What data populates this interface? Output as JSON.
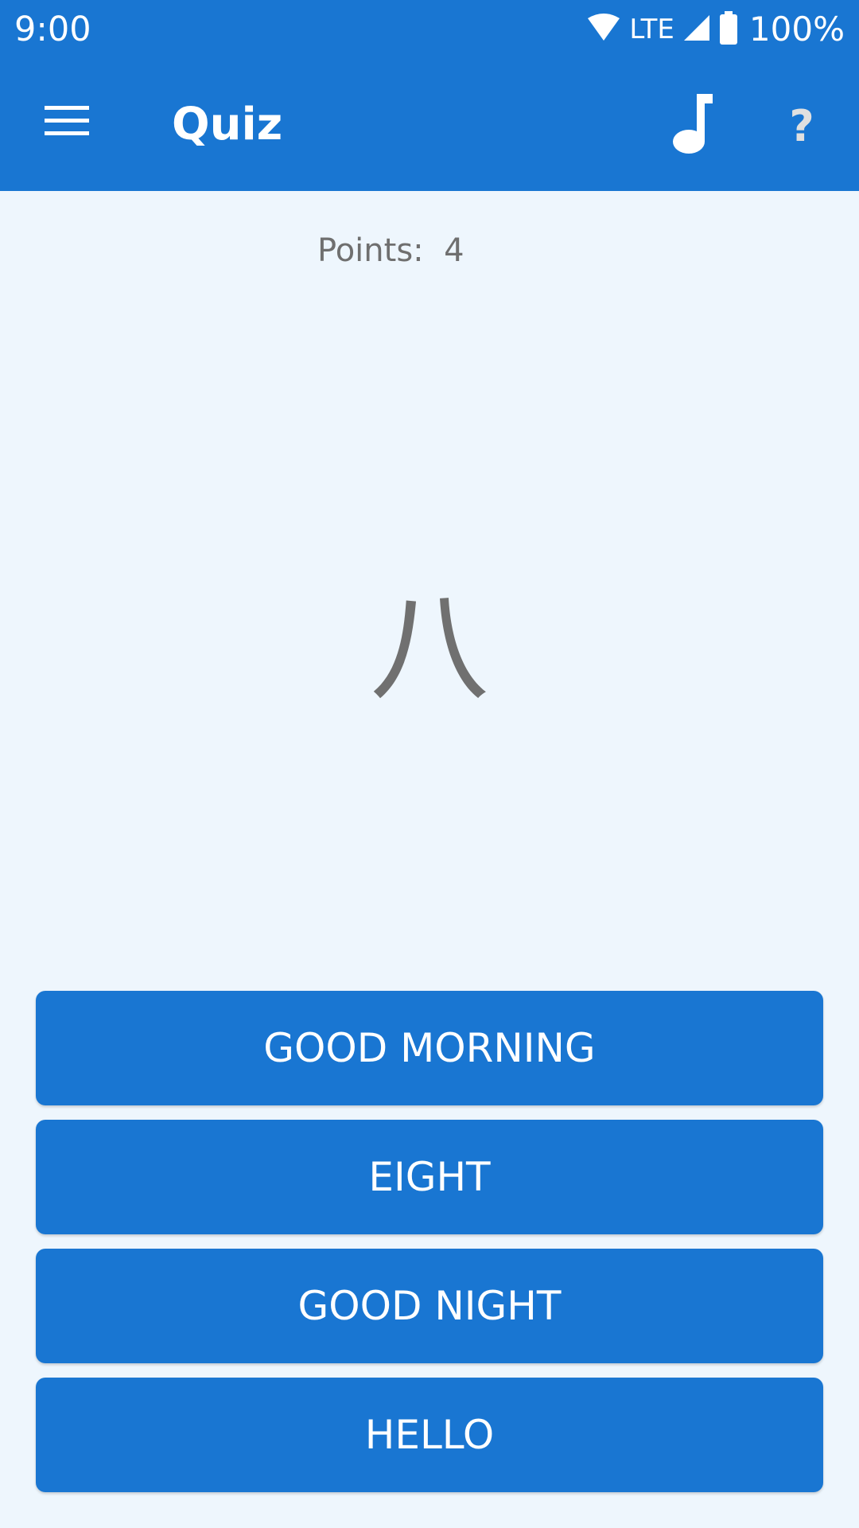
{
  "status_bar": {
    "time": "9:00",
    "network": "LTE",
    "battery": "100%",
    "icons": [
      "wifi-icon",
      "cell-signal-icon",
      "battery-icon"
    ]
  },
  "app_bar": {
    "title": "Quiz",
    "menu_icon": "hamburger-menu-icon",
    "music_icon": "music-note-icon",
    "help_label": "?"
  },
  "quiz": {
    "points_label": "Points:",
    "points_value": "4",
    "question": "八",
    "answers": [
      "GOOD MORNING",
      "EIGHT",
      "GOOD NIGHT",
      "HELLO"
    ]
  },
  "colors": {
    "primary": "#1976D2",
    "background": "#EEF6FD",
    "text_muted": "#707070"
  }
}
